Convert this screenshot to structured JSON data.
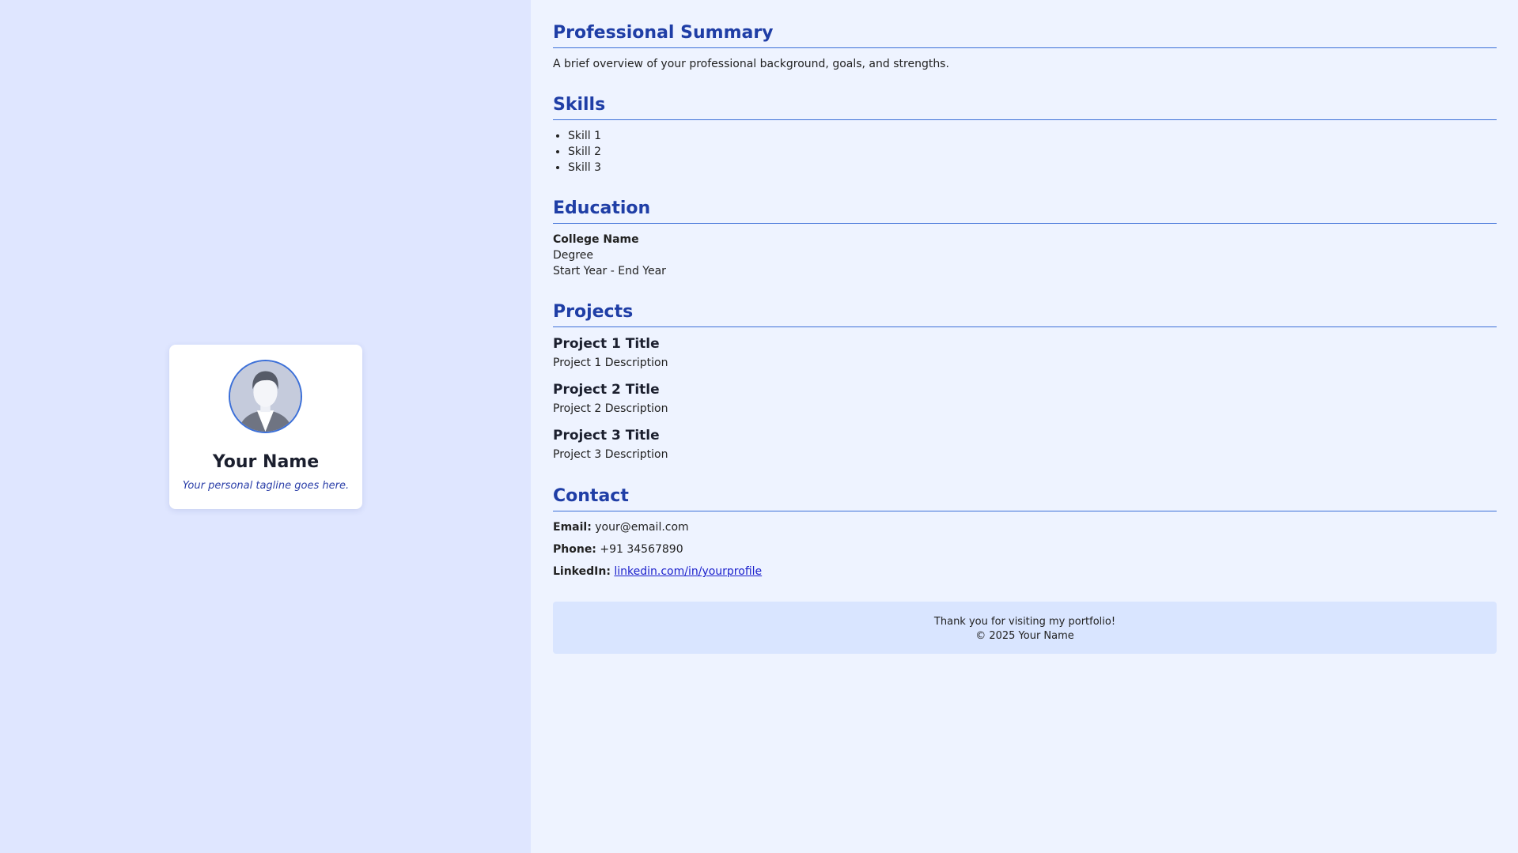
{
  "profile": {
    "name": "Your Name",
    "tagline": "Your personal tagline goes here."
  },
  "summary": {
    "heading": "Professional Summary",
    "text": "A brief overview of your professional background, goals, and strengths."
  },
  "skills": {
    "heading": "Skills",
    "items": [
      "Skill 1",
      "Skill 2",
      "Skill 3"
    ]
  },
  "education": {
    "heading": "Education",
    "college": "College Name",
    "degree": "Degree",
    "years": "Start Year - End Year"
  },
  "projects": {
    "heading": "Projects",
    "items": [
      {
        "title": "Project 1 Title",
        "description": "Project 1 Description"
      },
      {
        "title": "Project 2 Title",
        "description": "Project 2 Description"
      },
      {
        "title": "Project 3 Title",
        "description": "Project 3 Description"
      }
    ]
  },
  "contact": {
    "heading": "Contact",
    "email_label": "Email:",
    "email": "your@email.com",
    "phone_label": "Phone:",
    "phone": "+91 34567890",
    "linkedin_label": "LinkedIn:",
    "linkedin": "linkedin.com/in/yourprofile"
  },
  "footer": {
    "line1": "Thank you for visiting my portfolio!",
    "line2": "© 2025 Your Name"
  },
  "colors": {
    "left_bg": "#dfe6ff",
    "right_bg": "#eef3ff",
    "heading": "#1f3ea6",
    "accent": "#3b6fd8",
    "footer_bg": "#d9e5ff"
  }
}
